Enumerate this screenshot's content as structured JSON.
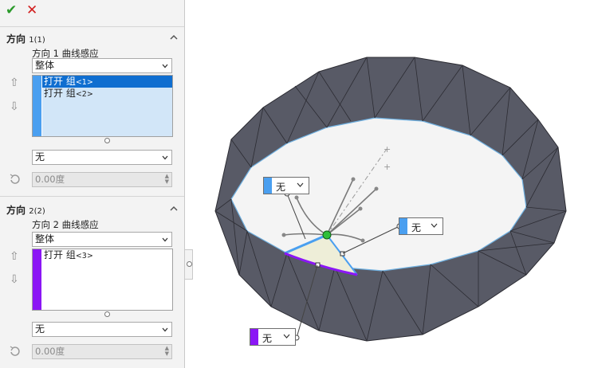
{
  "panel": {
    "confirm_icon": "checkmark-icon",
    "cancel_icon": "close-icon",
    "direction1": {
      "title": "方向",
      "count": "1(1)",
      "curve_label": "方向 1 曲线感应",
      "mode": "整体",
      "items": [
        {
          "name": "打开 组",
          "suffix": "<1>",
          "selected": true
        },
        {
          "name": "打开 组",
          "suffix": "<2>",
          "selected": false
        }
      ],
      "tangency": "无",
      "angle": "0.00度",
      "color": "#4a9ff0"
    },
    "direction2": {
      "title": "方向",
      "count": "2(2)",
      "curve_label": "方向 2 曲线感应",
      "mode": "整体",
      "items": [
        {
          "name": "打开 组",
          "suffix": "<3>",
          "selected": false
        }
      ],
      "tangency": "无",
      "angle": "0.00度",
      "color": "#8b16f5"
    }
  },
  "viewport": {
    "callouts": [
      {
        "label": "无",
        "color": "#4a9ff0"
      },
      {
        "label": "无",
        "color": "#4a9ff0"
      },
      {
        "label": "无",
        "color": "#8b16f5"
      }
    ]
  }
}
